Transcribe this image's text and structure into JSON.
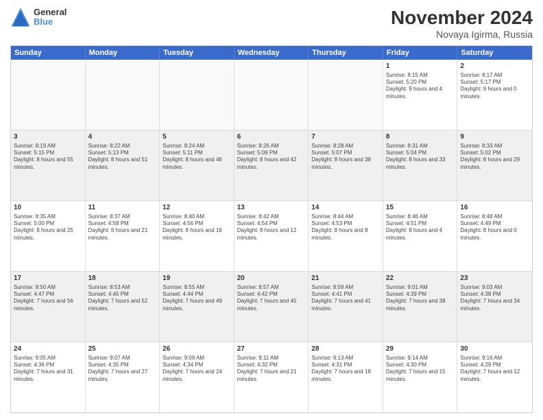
{
  "logo": {
    "line1": "General",
    "line2": "Blue"
  },
  "title": "November 2024",
  "subtitle": "Novaya Igirma, Russia",
  "days": [
    "Sunday",
    "Monday",
    "Tuesday",
    "Wednesday",
    "Thursday",
    "Friday",
    "Saturday"
  ],
  "rows": [
    [
      {
        "day": "",
        "info": ""
      },
      {
        "day": "",
        "info": ""
      },
      {
        "day": "",
        "info": ""
      },
      {
        "day": "",
        "info": ""
      },
      {
        "day": "",
        "info": ""
      },
      {
        "day": "1",
        "info": "Sunrise: 8:15 AM\nSunset: 5:20 PM\nDaylight: 9 hours and 4 minutes."
      },
      {
        "day": "2",
        "info": "Sunrise: 8:17 AM\nSunset: 5:17 PM\nDaylight: 9 hours and 0 minutes."
      }
    ],
    [
      {
        "day": "3",
        "info": "Sunrise: 8:19 AM\nSunset: 5:15 PM\nDaylight: 8 hours and 55 minutes."
      },
      {
        "day": "4",
        "info": "Sunrise: 8:22 AM\nSunset: 5:13 PM\nDaylight: 8 hours and 51 minutes."
      },
      {
        "day": "5",
        "info": "Sunrise: 8:24 AM\nSunset: 5:11 PM\nDaylight: 8 hours and 46 minutes."
      },
      {
        "day": "6",
        "info": "Sunrise: 8:26 AM\nSunset: 5:09 PM\nDaylight: 8 hours and 42 minutes."
      },
      {
        "day": "7",
        "info": "Sunrise: 8:28 AM\nSunset: 5:07 PM\nDaylight: 8 hours and 38 minutes."
      },
      {
        "day": "8",
        "info": "Sunrise: 8:31 AM\nSunset: 5:04 PM\nDaylight: 8 hours and 33 minutes."
      },
      {
        "day": "9",
        "info": "Sunrise: 8:33 AM\nSunset: 5:02 PM\nDaylight: 8 hours and 29 minutes."
      }
    ],
    [
      {
        "day": "10",
        "info": "Sunrise: 8:35 AM\nSunset: 5:00 PM\nDaylight: 8 hours and 25 minutes."
      },
      {
        "day": "11",
        "info": "Sunrise: 8:37 AM\nSunset: 4:58 PM\nDaylight: 8 hours and 21 minutes."
      },
      {
        "day": "12",
        "info": "Sunrise: 8:40 AM\nSunset: 4:56 PM\nDaylight: 8 hours and 16 minutes."
      },
      {
        "day": "13",
        "info": "Sunrise: 8:42 AM\nSunset: 4:54 PM\nDaylight: 8 hours and 12 minutes."
      },
      {
        "day": "14",
        "info": "Sunrise: 8:44 AM\nSunset: 4:53 PM\nDaylight: 8 hours and 8 minutes."
      },
      {
        "day": "15",
        "info": "Sunrise: 8:46 AM\nSunset: 4:51 PM\nDaylight: 8 hours and 4 minutes."
      },
      {
        "day": "16",
        "info": "Sunrise: 8:48 AM\nSunset: 4:49 PM\nDaylight: 8 hours and 0 minutes."
      }
    ],
    [
      {
        "day": "17",
        "info": "Sunrise: 8:50 AM\nSunset: 4:47 PM\nDaylight: 7 hours and 56 minutes."
      },
      {
        "day": "18",
        "info": "Sunrise: 8:53 AM\nSunset: 4:45 PM\nDaylight: 7 hours and 52 minutes."
      },
      {
        "day": "19",
        "info": "Sunrise: 8:55 AM\nSunset: 4:44 PM\nDaylight: 7 hours and 49 minutes."
      },
      {
        "day": "20",
        "info": "Sunrise: 8:57 AM\nSunset: 4:42 PM\nDaylight: 7 hours and 45 minutes."
      },
      {
        "day": "21",
        "info": "Sunrise: 8:59 AM\nSunset: 4:41 PM\nDaylight: 7 hours and 41 minutes."
      },
      {
        "day": "22",
        "info": "Sunrise: 9:01 AM\nSunset: 4:39 PM\nDaylight: 7 hours and 38 minutes."
      },
      {
        "day": "23",
        "info": "Sunrise: 9:03 AM\nSunset: 4:38 PM\nDaylight: 7 hours and 34 minutes."
      }
    ],
    [
      {
        "day": "24",
        "info": "Sunrise: 9:05 AM\nSunset: 4:36 PM\nDaylight: 7 hours and 31 minutes."
      },
      {
        "day": "25",
        "info": "Sunrise: 9:07 AM\nSunset: 4:35 PM\nDaylight: 7 hours and 27 minutes."
      },
      {
        "day": "26",
        "info": "Sunrise: 9:09 AM\nSunset: 4:34 PM\nDaylight: 7 hours and 24 minutes."
      },
      {
        "day": "27",
        "info": "Sunrise: 9:11 AM\nSunset: 4:32 PM\nDaylight: 7 hours and 21 minutes."
      },
      {
        "day": "28",
        "info": "Sunrise: 9:13 AM\nSunset: 4:31 PM\nDaylight: 7 hours and 18 minutes."
      },
      {
        "day": "29",
        "info": "Sunrise: 9:14 AM\nSunset: 4:30 PM\nDaylight: 7 hours and 15 minutes."
      },
      {
        "day": "30",
        "info": "Sunrise: 9:16 AM\nSunset: 4:29 PM\nDaylight: 7 hours and 12 minutes."
      }
    ]
  ]
}
